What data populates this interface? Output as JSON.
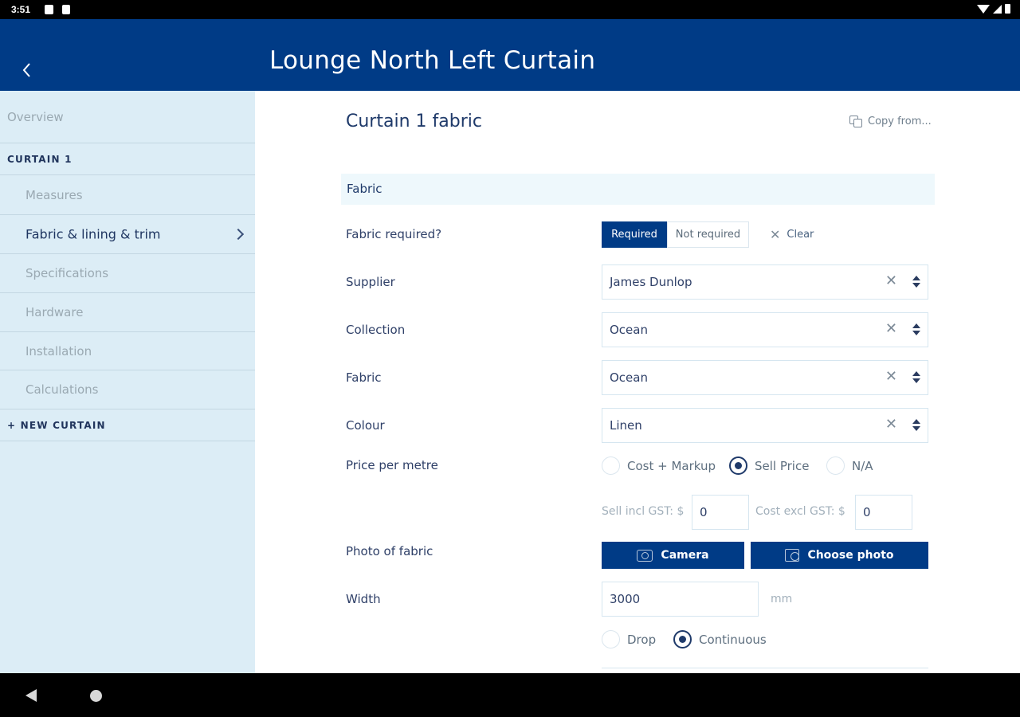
{
  "status": {
    "time": "3:51"
  },
  "appbar": {
    "title": "Lounge North Left Curtain"
  },
  "sidebar": {
    "items": [
      {
        "label": "Overview"
      },
      {
        "label": "CURTAIN 1"
      },
      {
        "label": "Measures"
      },
      {
        "label": "Fabric & lining & trim"
      },
      {
        "label": "Specifications"
      },
      {
        "label": "Hardware"
      },
      {
        "label": "Installation"
      },
      {
        "label": "Calculations"
      },
      {
        "label": "+ NEW CURTAIN"
      }
    ]
  },
  "main": {
    "title": "Curtain 1 fabric",
    "copy_label": "Copy from...",
    "section_title": "Fabric",
    "fabric_required": {
      "label": "Fabric required?",
      "options": [
        "Required",
        "Not required"
      ],
      "selected": "Required",
      "clear_label": "Clear"
    },
    "supplier": {
      "label": "Supplier",
      "value": "James Dunlop"
    },
    "collection": {
      "label": "Collection",
      "value": "Ocean"
    },
    "fabric": {
      "label": "Fabric",
      "value": "Ocean"
    },
    "colour": {
      "label": "Colour",
      "value": "Linen"
    },
    "price": {
      "label": "Price per metre",
      "options": [
        "Cost + Markup",
        "Sell Price",
        "N/A"
      ],
      "selected": "Sell Price",
      "sell_label": "Sell incl GST: $",
      "sell_value": "0",
      "cost_label": "Cost excl GST: $",
      "cost_value": "0"
    },
    "photo": {
      "label": "Photo of fabric",
      "camera_label": "Camera",
      "choose_label": "Choose photo"
    },
    "width": {
      "label": "Width",
      "value": "3000",
      "unit": "mm",
      "options": [
        "Drop",
        "Continuous"
      ],
      "selected": "Continuous"
    }
  }
}
